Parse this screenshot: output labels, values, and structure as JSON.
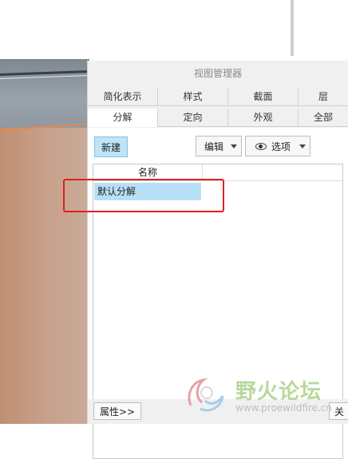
{
  "panel": {
    "title": "视图管理器",
    "tabs_row1": [
      "简化表示",
      "样式",
      "截面",
      "层"
    ],
    "tabs_row2": [
      "分解",
      "定向",
      "外观",
      "全部"
    ],
    "active_tab": "分解"
  },
  "toolbar": {
    "new_label": "新建",
    "edit_label": "编辑",
    "options_label": "选项"
  },
  "list": {
    "column_name": "名称",
    "rows": [
      "默认分解"
    ]
  },
  "footer": {
    "properties_label": "属性>>",
    "close_label": "关闭"
  },
  "watermark": {
    "text": "野火论坛",
    "url": "www.proewildfire.cn"
  },
  "colors": {
    "selection": "#b7e0f7",
    "new_button": "#bfe3f7",
    "highlight_box": "#e02020",
    "watermark_green": "#b8d89a"
  }
}
